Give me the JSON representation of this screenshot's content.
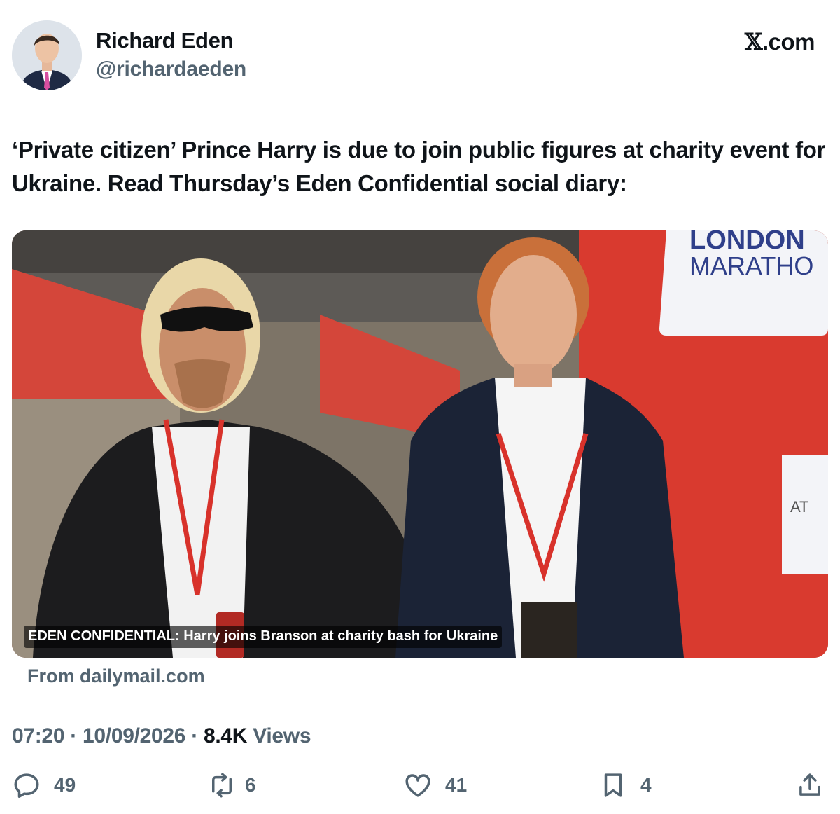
{
  "author": {
    "name": "Richard Eden",
    "handle": "@richardaeden"
  },
  "brand": {
    "logo_letter": "𝕏",
    "suffix": ".com"
  },
  "tweet": {
    "text": "‘Private citizen’ Prince Harry is due to join public figures at charity event for Ukraine. Read Thursday’s Eden Confidential social diary:"
  },
  "card": {
    "caption": "EDEN CONFIDENTIAL: Harry joins Branson at charity bash for Ukraine",
    "sign_line1": "LONDON",
    "sign_line2": "MARATHO",
    "sign_fragment": "AT",
    "source": "From dailymail.com"
  },
  "meta": {
    "time": "07:20",
    "date": "10/09/2026",
    "views_count": "8.4K",
    "views_label": "Views",
    "separator": "·"
  },
  "actions": {
    "replies": "49",
    "reposts": "6",
    "likes": "41",
    "bookmarks": "4"
  },
  "colors": {
    "text_primary": "#0f1419",
    "text_secondary": "#536471",
    "marathon_red": "#d93a2f"
  }
}
